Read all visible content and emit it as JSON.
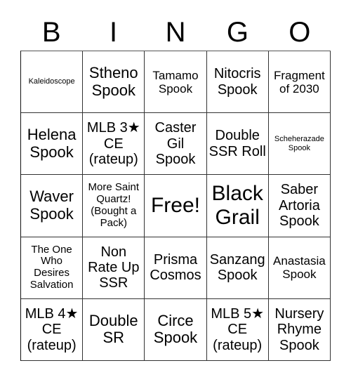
{
  "header": {
    "letters": [
      "B",
      "I",
      "N",
      "G",
      "O"
    ]
  },
  "cells": [
    [
      "Kaleidoscope",
      "Stheno Spook",
      "Tamamo Spook",
      "Nitocris Spook",
      "Fragment of 2030"
    ],
    [
      "Helena Spook",
      "MLB 3★ CE (rateup)",
      "Caster Gil Spook",
      "Double SSR Roll",
      "Scheherazade Spook"
    ],
    [
      "Waver Spook",
      "More Saint Quartz! (Bought a Pack)",
      "Free!",
      "Black Grail",
      "Saber Artoria Spook"
    ],
    [
      "The One Who Desires Salvation",
      "Non Rate Up SSR",
      "Prisma Cosmos",
      "Sanzang Spook",
      "Anastasia Spook"
    ],
    [
      "MLB 4★ CE (rateup)",
      "Double SR",
      "Circe Spook",
      "MLB 5★ CE (rateup)",
      "Nursery Rhyme Spook"
    ]
  ]
}
